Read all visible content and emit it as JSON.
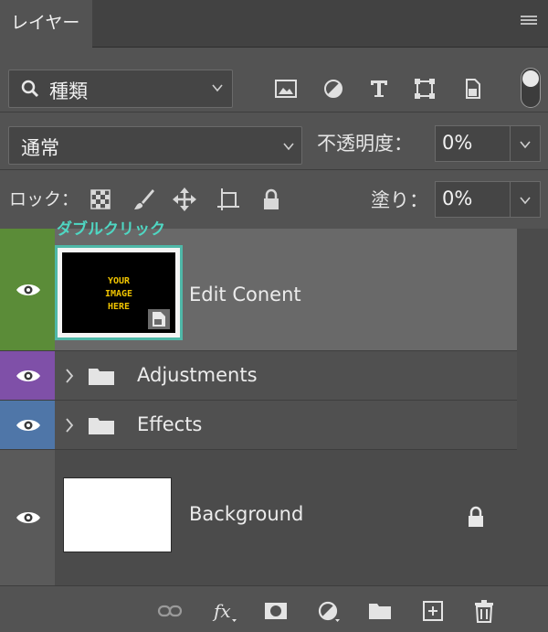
{
  "panel": {
    "tab_label": "レイヤー",
    "callout": "ダブルクリック"
  },
  "filter": {
    "kind_label": "種類"
  },
  "blend": {
    "mode_label": "通常",
    "opacity_label": "不透明度：",
    "opacity_value": "0%"
  },
  "lock": {
    "label": "ロック：",
    "fill_label": "塗り：",
    "fill_value": "0%"
  },
  "layers": [
    {
      "name": "Edit Conent",
      "type": "smart-object",
      "color_tag": "#5b8c38",
      "selected": true,
      "thumb_text": "YOUR\nIMAGE\nHERE"
    },
    {
      "name": "Adjustments",
      "type": "group",
      "color_tag": "#7f50a8"
    },
    {
      "name": "Effects",
      "type": "group",
      "color_tag": "#4f76a8"
    },
    {
      "name": "Background",
      "type": "background",
      "color_tag": "#5a5a5a",
      "locked": true
    }
  ],
  "colors": {
    "panel": "#535353",
    "selected_row": "#696969",
    "callout": "#4fd7c3",
    "thumb_border": "#4fb8a8"
  }
}
